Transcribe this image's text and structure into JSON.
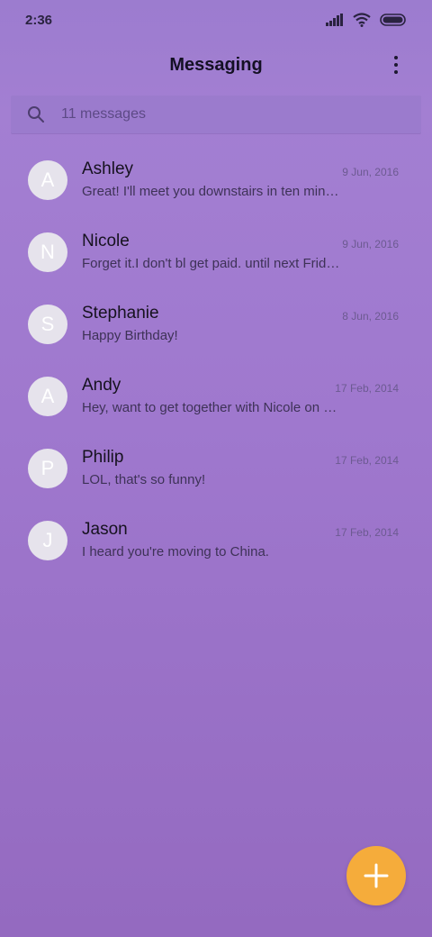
{
  "status_bar": {
    "time": "2:36"
  },
  "app_bar": {
    "title": "Messaging"
  },
  "search": {
    "placeholder": "11 messages"
  },
  "conversations": [
    {
      "initial": "A",
      "name": "Ashley",
      "date": "9 Jun, 2016",
      "snippet": "Great! I'll meet you downstairs in ten min…"
    },
    {
      "initial": "N",
      "name": "Nicole",
      "date": "9 Jun, 2016",
      "snippet": "Forget it.I don't bl get paid. until next Frid…"
    },
    {
      "initial": "S",
      "name": "Stephanie",
      "date": "8 Jun, 2016",
      "snippet": "Happy Birthday!"
    },
    {
      "initial": "A",
      "name": "Andy",
      "date": "17 Feb, 2014",
      "snippet": "Hey, want to get together with Nicole on …"
    },
    {
      "initial": "P",
      "name": "Philip",
      "date": "17 Feb, 2014",
      "snippet": "LOL, that's so funny!"
    },
    {
      "initial": "J",
      "name": "Jason",
      "date": "17 Feb, 2014",
      "snippet": "I heard you're moving to China."
    }
  ],
  "colors": {
    "accent_fab": "#f5ac3b",
    "background": "#9f78ce",
    "avatar": "#e6e3ec"
  },
  "icons": {
    "search": "search-icon",
    "menu": "more-vert-icon",
    "compose": "plus-icon"
  }
}
